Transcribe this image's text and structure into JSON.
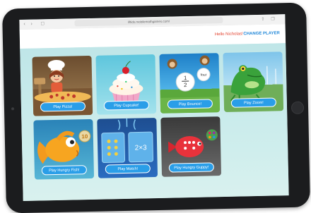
{
  "browser": {
    "url": "liftids.mobilemathgames.com/",
    "back_glyph": "‹",
    "forward_glyph": "›"
  },
  "header": {
    "greeting": "Hello Nicholas!",
    "change_player": "CHANGE PLAYER"
  },
  "games": [
    {
      "label": "Play Pizza!",
      "icon": "pizza-chef"
    },
    {
      "label": "Play Cupcake!",
      "icon": "cupcake"
    },
    {
      "label": "Play Bounce!",
      "icon": "monkeys-fraction"
    },
    {
      "label": "Play Zoom!",
      "icon": "frog"
    },
    {
      "label": "Play Hungry Fish!",
      "icon": "goldfish",
      "badge": "10"
    },
    {
      "label": "Play Match!",
      "icon": "match-cards",
      "expression": "2×3"
    },
    {
      "label": "Play Hungry Guppy!",
      "icon": "guppy"
    }
  ],
  "bounce_fraction": {
    "num": "1",
    "den": "2"
  },
  "bounce_ball_text": "four"
}
